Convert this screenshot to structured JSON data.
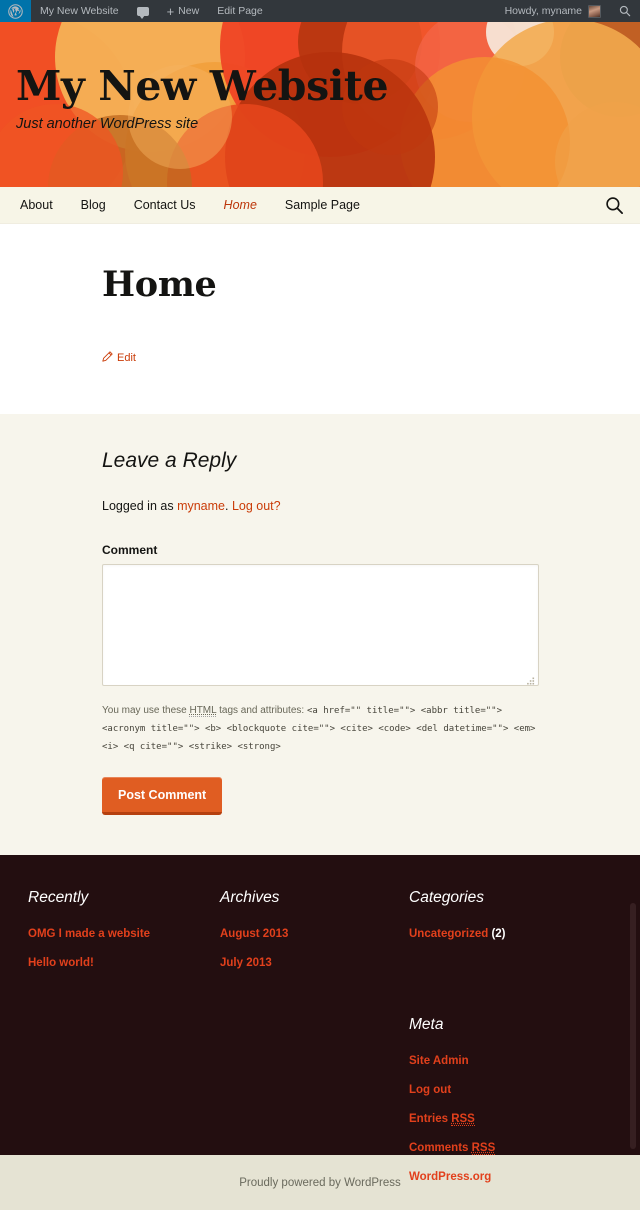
{
  "admin_bar": {
    "wp_logo": "wordpress-logo",
    "site_name": "My New Website",
    "comments_label": "",
    "new_label": "New",
    "new_plus": "+",
    "edit_page_label": "Edit Page",
    "howdy": "Howdy, myname",
    "search_glyph": "⌕"
  },
  "header": {
    "site_title": "My New Website",
    "tagline": "Just another WordPress site"
  },
  "nav": {
    "items": [
      {
        "label": "About",
        "current": false
      },
      {
        "label": "Blog",
        "current": false
      },
      {
        "label": "Contact Us",
        "current": false
      },
      {
        "label": "Home",
        "current": true
      },
      {
        "label": "Sample Page",
        "current": false
      }
    ],
    "search_icon": "search-icon"
  },
  "main": {
    "page_title": "Home",
    "edit_label": "Edit"
  },
  "comments": {
    "reply_title": "Leave a Reply",
    "logged_in_prefix": "Logged in as ",
    "username": "myname",
    "logged_in_sep": ". ",
    "logout_label": "Log out?",
    "comment_label": "Comment",
    "comment_value": "",
    "allowed_tags_prefix": "You may use these ",
    "allowed_tags_abbr": "HTML",
    "allowed_tags_mid": " tags and attributes: ",
    "allowed_tags_code": "<a href=\"\" title=\"\"> <abbr title=\"\"> <acronym title=\"\"> <b> <blockquote cite=\"\"> <cite> <code> <del datetime=\"\"> <em> <i> <q cite=\"\"> <strike> <strong>",
    "submit_label": "Post Comment"
  },
  "footer": {
    "widgets": [
      {
        "title": "Recently",
        "items": [
          {
            "label": "OMG I made a website"
          },
          {
            "label": "Hello world!"
          }
        ]
      },
      {
        "title": "Archives",
        "items": [
          {
            "label": "August 2013"
          },
          {
            "label": "July 2013"
          }
        ]
      },
      {
        "title": "Categories",
        "items": [
          {
            "label": "Uncategorized",
            "count": "(2)"
          }
        ]
      },
      {
        "title": "Meta",
        "items": [
          {
            "label": "Site Admin"
          },
          {
            "label": "Log out"
          },
          {
            "label": "Entries ",
            "abbr": "RSS"
          },
          {
            "label": "Comments ",
            "abbr": "RSS"
          },
          {
            "label": "WordPress.org"
          }
        ]
      }
    ],
    "credit": "Proudly powered by WordPress"
  },
  "colors": {
    "admin_bar_bg": "#32373c",
    "header_orange": "#e8623a",
    "nav_bg": "#f7f5e7",
    "accent_red": "#ca3c08",
    "link_red": "#e2401c",
    "button_orange": "#e05d22",
    "comments_bg": "#f7f5ec",
    "footer_bg": "#230e10",
    "credit_bg": "#e5e3d3"
  }
}
